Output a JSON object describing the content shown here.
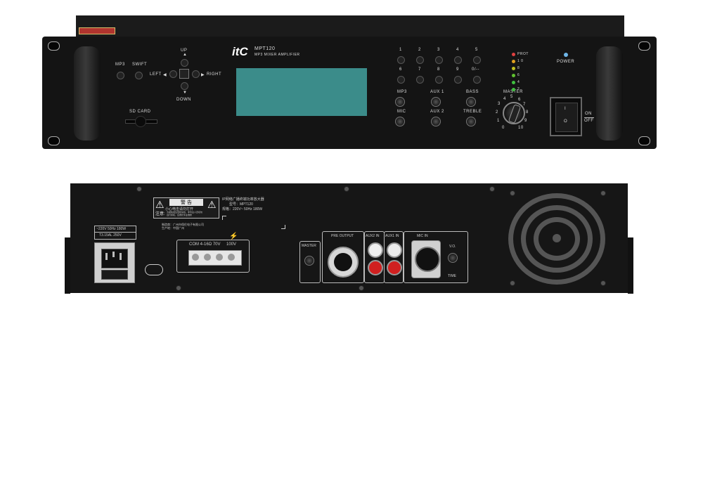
{
  "front": {
    "brand": "itC",
    "model": "MPT120",
    "subtitle": "MP3 MIXER AMPLIFIER",
    "buttons": {
      "mp3": "MP3",
      "swift": "SWIFT",
      "up": "UP",
      "down": "DOWN",
      "left": "LEFT",
      "right": "RIGHT"
    },
    "sd_card": "SD CARD",
    "keypad": [
      "1",
      "2",
      "3",
      "4",
      "5",
      "6",
      "7",
      "8",
      "9",
      "0/--"
    ],
    "knobs": {
      "mp3": "MP3",
      "mic": "MIC",
      "aux1": "AUX 1",
      "aux2": "AUX 2",
      "bass": "BASS",
      "treble": "TREBLE",
      "master": "MASTER"
    },
    "master_scale": [
      "0",
      "1",
      "2",
      "3",
      "4",
      "5",
      "6",
      "7",
      "8",
      "9",
      "10"
    ],
    "leds": [
      {
        "label": "PROT",
        "color": "#e04040"
      },
      {
        "label": "1 0",
        "color": "#e0a020"
      },
      {
        "label": "8",
        "color": "#c0c020"
      },
      {
        "label": "6",
        "color": "#60c030"
      },
      {
        "label": "4",
        "color": "#40c040"
      },
      {
        "label": "2",
        "color": "#40c040"
      }
    ],
    "power": "POWER",
    "power_led_color": "#6fb6e8",
    "switch_on": "ON",
    "switch_off": "OFF",
    "switch_i": "I",
    "switch_o": "O"
  },
  "rear": {
    "warning_title": "警  告",
    "warning_caution": "注意:",
    "warning_line1": "小心电击请勿打开",
    "warning_line2": "为避免发生危险请勿，非专业人员切勿",
    "warning_line3": "自行拆机，应委托专业维修",
    "maker1": "制造商：广州市保伦电子有限公司",
    "maker2": "生产地：中国广州",
    "product_title": "IP网络广播终端功率放大器",
    "product_model": "型号：MPT120",
    "product_spec": "规格：220V~ 50Hz 180W",
    "power_rating": "~220V  50Hz  180W",
    "fuse": "T3.15AL  250V",
    "speaker_com": "COM 4-16Ω  70V",
    "speaker_100v": "100V",
    "master": "MASTER",
    "pre_output": "PRE OUTPUT",
    "aux2_in": "AUX2 IN",
    "aux1_in": "AUX1 IN",
    "mic_in": "MIC IN",
    "vo": "V.O.",
    "time": "TIME"
  }
}
